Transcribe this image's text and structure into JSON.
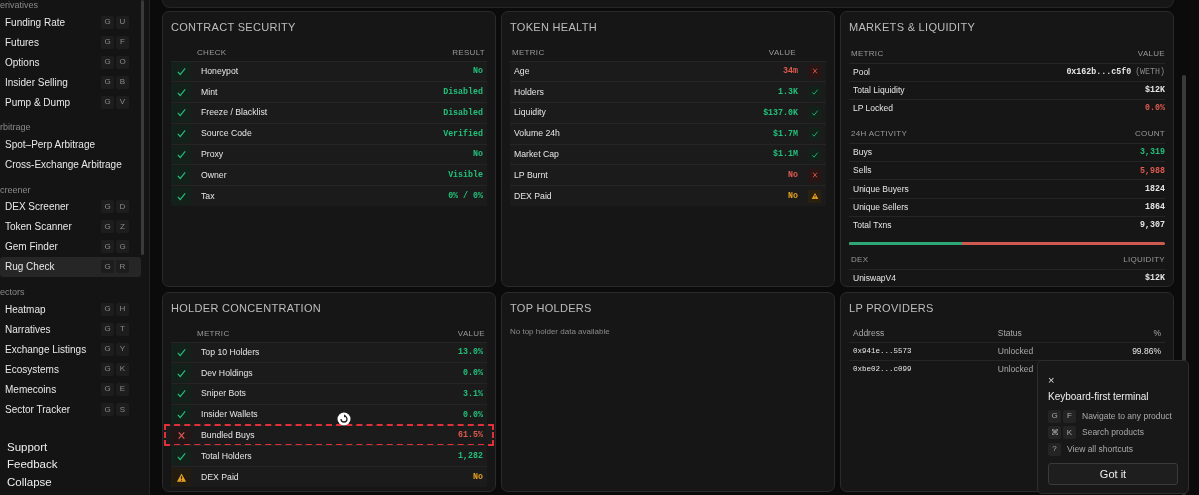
{
  "sidebar": {
    "sections": [
      {
        "label": "erivatives",
        "items": [
          {
            "label": "Funding Rate",
            "keys": [
              "G",
              "U"
            ],
            "selected": false
          },
          {
            "label": "Futures",
            "keys": [
              "G",
              "F"
            ],
            "selected": false
          },
          {
            "label": "Options",
            "keys": [
              "G",
              "O"
            ],
            "selected": false
          },
          {
            "label": "Insider Selling",
            "keys": [
              "G",
              "B"
            ],
            "selected": false
          },
          {
            "label": "Pump & Dump",
            "keys": [
              "G",
              "V"
            ],
            "selected": false
          }
        ]
      },
      {
        "label": "rbitrage",
        "items": [
          {
            "label": "Spot–Perp Arbitrage",
            "selected": false
          },
          {
            "label": "Cross-Exchange Arbitrage",
            "selected": false
          }
        ]
      },
      {
        "label": "creener",
        "items": [
          {
            "label": "DEX Screener",
            "keys": [
              "G",
              "D"
            ],
            "selected": false
          },
          {
            "label": "Token Scanner",
            "keys": [
              "G",
              "Z"
            ],
            "selected": false
          },
          {
            "label": "Gem Finder",
            "keys": [
              "G",
              "G"
            ],
            "selected": false
          },
          {
            "label": "Rug Check",
            "keys": [
              "G",
              "R"
            ],
            "selected": true
          }
        ]
      },
      {
        "label": "ectors",
        "items": [
          {
            "label": "Heatmap",
            "keys": [
              "G",
              "H"
            ],
            "selected": false
          },
          {
            "label": "Narratives",
            "keys": [
              "G",
              "T"
            ],
            "selected": false
          },
          {
            "label": "Exchange Listings",
            "keys": [
              "G",
              "Y"
            ],
            "selected": false
          },
          {
            "label": "Ecosystems",
            "keys": [
              "G",
              "K"
            ],
            "selected": false
          },
          {
            "label": "Memecoins",
            "keys": [
              "G",
              "E"
            ],
            "selected": false
          },
          {
            "label": "Sector Tracker",
            "keys": [
              "G",
              "S"
            ],
            "selected": false
          }
        ]
      }
    ],
    "footer": [
      "Support",
      "Feedback",
      "Collapse"
    ]
  },
  "contract_security": {
    "title": "CONTRACT SECURITY",
    "columns": [
      "CHECK",
      "RESULT"
    ],
    "rows": [
      {
        "kind": "pass",
        "check": "Honeypot",
        "result": "No"
      },
      {
        "kind": "pass",
        "check": "Mint",
        "result": "Disabled"
      },
      {
        "kind": "pass",
        "check": "Freeze / Blacklist",
        "result": "Disabled"
      },
      {
        "kind": "pass",
        "check": "Source Code",
        "result": "Verified"
      },
      {
        "kind": "pass",
        "check": "Proxy",
        "result": "No"
      },
      {
        "kind": "pass",
        "check": "Owner",
        "result": "Visible"
      },
      {
        "kind": "pass",
        "check": "Tax",
        "result": "0% / 0%"
      }
    ]
  },
  "token_health": {
    "title": "TOKEN HEALTH",
    "columns": [
      "METRIC",
      "VALUE"
    ],
    "rows": [
      {
        "metric": "Age",
        "value": "34m",
        "kind": "fail"
      },
      {
        "metric": "Holders",
        "value": "1.3K",
        "kind": "pass"
      },
      {
        "metric": "Liquidity",
        "value": "$137.0K",
        "kind": "pass"
      },
      {
        "metric": "Volume 24h",
        "value": "$1.7M",
        "kind": "pass"
      },
      {
        "metric": "Market Cap",
        "value": "$1.1M",
        "kind": "pass"
      },
      {
        "metric": "LP Burnt",
        "value": "No",
        "kind": "fail"
      },
      {
        "metric": "DEX Paid",
        "value": "No",
        "kind": "warn"
      }
    ]
  },
  "markets_liquidity": {
    "title": "MARKETS & LIQUIDITY",
    "pool_table": {
      "columns": [
        "METRIC",
        "VALUE"
      ],
      "rows": [
        {
          "metric": "Pool",
          "value": "0x162b...c5f0",
          "suffix": "(WETH)",
          "color": "#e6e6e6"
        },
        {
          "metric": "Total Liquidity",
          "value": "$12K",
          "color": "#e6e6e6"
        },
        {
          "metric": "LP Locked",
          "value": "0.0%",
          "color": "#e05a4f"
        }
      ]
    },
    "activity_table": {
      "columns": [
        "24H ACTIVITY",
        "COUNT"
      ],
      "rows": [
        {
          "metric": "Buys",
          "value": "3,319",
          "color": "#22c07a"
        },
        {
          "metric": "Sells",
          "value": "5,988",
          "color": "#e05a4f"
        },
        {
          "metric": "Unique Buyers",
          "value": "1824",
          "color": "#e6e6e6"
        },
        {
          "metric": "Unique Sellers",
          "value": "1864",
          "color": "#e6e6e6"
        },
        {
          "metric": "Total Txns",
          "value": "9,307",
          "color": "#e6e6e6"
        }
      ]
    },
    "buy_ratio": {
      "level": 0.357
    },
    "dex_table": {
      "columns": [
        "DEX",
        "LIQUIDITY"
      ],
      "rows": [
        {
          "metric": "UniswapV4",
          "value": "$12K",
          "color": "#e6e6e6"
        }
      ]
    }
  },
  "holder_concentration": {
    "title": "HOLDER CONCENTRATION",
    "columns": [
      "METRIC",
      "VALUE"
    ],
    "rows": [
      {
        "kind": "pass",
        "metric": "Top 10 Holders",
        "value": "13.0%",
        "selected": false
      },
      {
        "kind": "pass",
        "metric": "Dev Holdings",
        "value": "0.0%",
        "selected": false
      },
      {
        "kind": "pass",
        "metric": "Sniper Bots",
        "value": "3.1%",
        "selected": false
      },
      {
        "kind": "pass",
        "metric": "Insider Wallets",
        "value": "0.0%",
        "selected": false
      },
      {
        "kind": "fail",
        "metric": "Bundled Buys",
        "value": "61.5%",
        "selected": true
      },
      {
        "kind": "pass",
        "metric": "Total Holders",
        "value": "1,282",
        "selected": false
      },
      {
        "kind": "warn",
        "metric": "DEX Paid",
        "value": "No",
        "selected": false
      }
    ]
  },
  "top_holders": {
    "title": "TOP HOLDERS",
    "empty_text": "No top holder data available"
  },
  "lp_providers": {
    "title": "LP PROVIDERS",
    "columns": [
      "Address",
      "Status",
      "%"
    ],
    "rows": [
      {
        "address": "0x941e...5573",
        "status": "Unlocked",
        "percent": "99.86%"
      },
      {
        "address": "0xbe02...c099",
        "status": "Unlocked"
      }
    ]
  },
  "shortcut_popup": {
    "close": "×",
    "title": "Keyboard-first terminal",
    "rows": [
      {
        "keys": [
          "G",
          "F"
        ],
        "text": "Navigate to any product"
      },
      {
        "keys": [
          "⌘",
          "K"
        ],
        "text": "Search products"
      },
      {
        "keys": [
          "?"
        ],
        "text": "View all shortcuts"
      }
    ],
    "button": "Got it"
  }
}
